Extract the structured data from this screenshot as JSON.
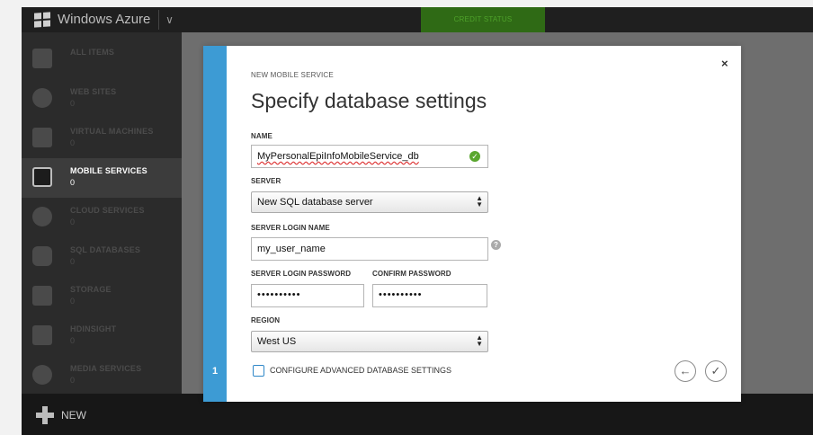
{
  "app": {
    "brand": "Windows Azure",
    "credit_status": "CREDIT STATUS",
    "new_label": "NEW"
  },
  "sidebar": {
    "items": [
      {
        "label": "ALL ITEMS",
        "count": "",
        "icon": "grid-icon"
      },
      {
        "label": "WEB SITES",
        "count": "0",
        "icon": "globe-icon"
      },
      {
        "label": "VIRTUAL MACHINES",
        "count": "0",
        "icon": "monitor-icon"
      },
      {
        "label": "MOBILE SERVICES",
        "count": "0",
        "icon": "mobile-icon",
        "active": true
      },
      {
        "label": "CLOUD SERVICES",
        "count": "0",
        "icon": "gears-icon"
      },
      {
        "label": "SQL DATABASES",
        "count": "0",
        "icon": "database-icon"
      },
      {
        "label": "STORAGE",
        "count": "0",
        "icon": "table-icon"
      },
      {
        "label": "HDINSIGHT",
        "count": "0",
        "icon": "elephant-icon"
      },
      {
        "label": "MEDIA SERVICES",
        "count": "0",
        "icon": "play-icon"
      }
    ]
  },
  "dialog": {
    "eyebrow": "NEW MOBILE SERVICE",
    "title": "Specify database settings",
    "step": "1",
    "close": "×",
    "name_label": "NAME",
    "name_value": "MyPersonalEpiInfoMobileService_db",
    "server_label": "SERVER",
    "server_value": "New SQL database server",
    "login_name_label": "SERVER LOGIN NAME",
    "login_name_value": "my_user_name",
    "login_password_label": "SERVER LOGIN PASSWORD",
    "login_password_value": "••••••••••",
    "confirm_password_label": "CONFIRM PASSWORD",
    "confirm_password_value": "••••••••••",
    "region_label": "REGION",
    "region_value": "West US",
    "advanced_label": "CONFIGURE ADVANCED DATABASE SETTINGS",
    "advanced_checked": false,
    "back_icon": "←",
    "finish_icon": "✓",
    "help_icon": "?"
  },
  "colors": {
    "accent": "#3d9bd4",
    "valid": "#5aa62f",
    "topbar": "#1f1f1f",
    "sidebar": "#2b2b2b"
  }
}
